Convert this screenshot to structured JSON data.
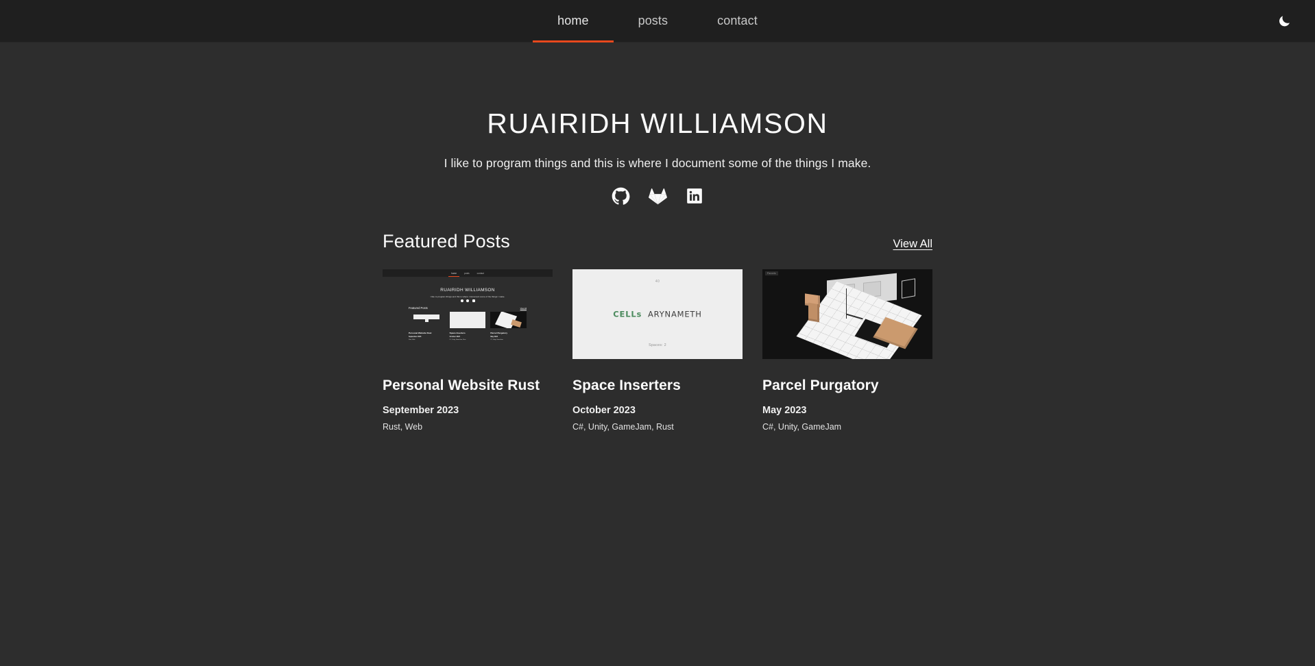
{
  "navbar": {
    "links": [
      {
        "label": "home",
        "active": true
      },
      {
        "label": "posts",
        "active": false
      },
      {
        "label": "contact",
        "active": false
      }
    ],
    "active_underline_color": "#e8491d",
    "theme_toggle_icon": "moon-icon",
    "background_color": "#1f1f1f"
  },
  "hero": {
    "title": "RUAIRIDH WILLIAMSON",
    "tagline": "I like to program things and this is where I document some of the things I make.",
    "socials": [
      {
        "name": "github",
        "icon": "github-icon"
      },
      {
        "name": "gitlab",
        "icon": "gitlab-icon"
      },
      {
        "name": "linkedin",
        "icon": "linkedin-icon"
      }
    ]
  },
  "featured": {
    "heading": "Featured Posts",
    "view_all_label": "View All",
    "posts": [
      {
        "title": "Personal Website Rust",
        "date": "September 2023",
        "tags": "Rust, Web",
        "thumbnail": "personal-website-screenshot",
        "thumb_nav": [
          "home",
          "posts",
          "contact"
        ],
        "thumb_title": "RUAIRIDH WILLIAMSON",
        "thumb_tagline": "I like to program things and this is where I document some of the things I make.",
        "thumb_featured_heading": "Featured Posts",
        "thumb_view_all": "View All",
        "thumb_cards": [
          {
            "title": "Personal Website Rust",
            "date": "September 2023",
            "tags": "Rust, Web"
          },
          {
            "title": "Space Inserters",
            "date": "October 2023",
            "tags": "C#, Unity, GameJam, Rust"
          },
          {
            "title": "Parcel Purgatory",
            "date": "May 2023",
            "tags": "C#, Unity, GameJam"
          }
        ]
      },
      {
        "title": "Space Inserters",
        "date": "October 2023",
        "tags": "C#, Unity, GameJam, Rust",
        "thumbnail": "space-inserters-title-screen",
        "thumb_top_text": "40",
        "thumb_main_green": "CELLs",
        "thumb_main_dark": "ARYNAMETH",
        "thumb_bottom_text": "Spaces: 2",
        "thumb_background_color": "#eeeeee",
        "thumb_accent_color": "#4c8b5e"
      },
      {
        "title": "Parcel Purgatory",
        "date": "May 2023",
        "tags": "C#, Unity, GameJam",
        "thumbnail": "parcel-purgatory-3d-scene",
        "thumb_hud_label": "Parcels",
        "thumb_background_color": "#121212"
      }
    ]
  },
  "theme": {
    "page_background": "#2d2d2d",
    "nav_background": "#1f1f1f",
    "text_color": "#f2f2f2",
    "accent": "#e8491d"
  }
}
